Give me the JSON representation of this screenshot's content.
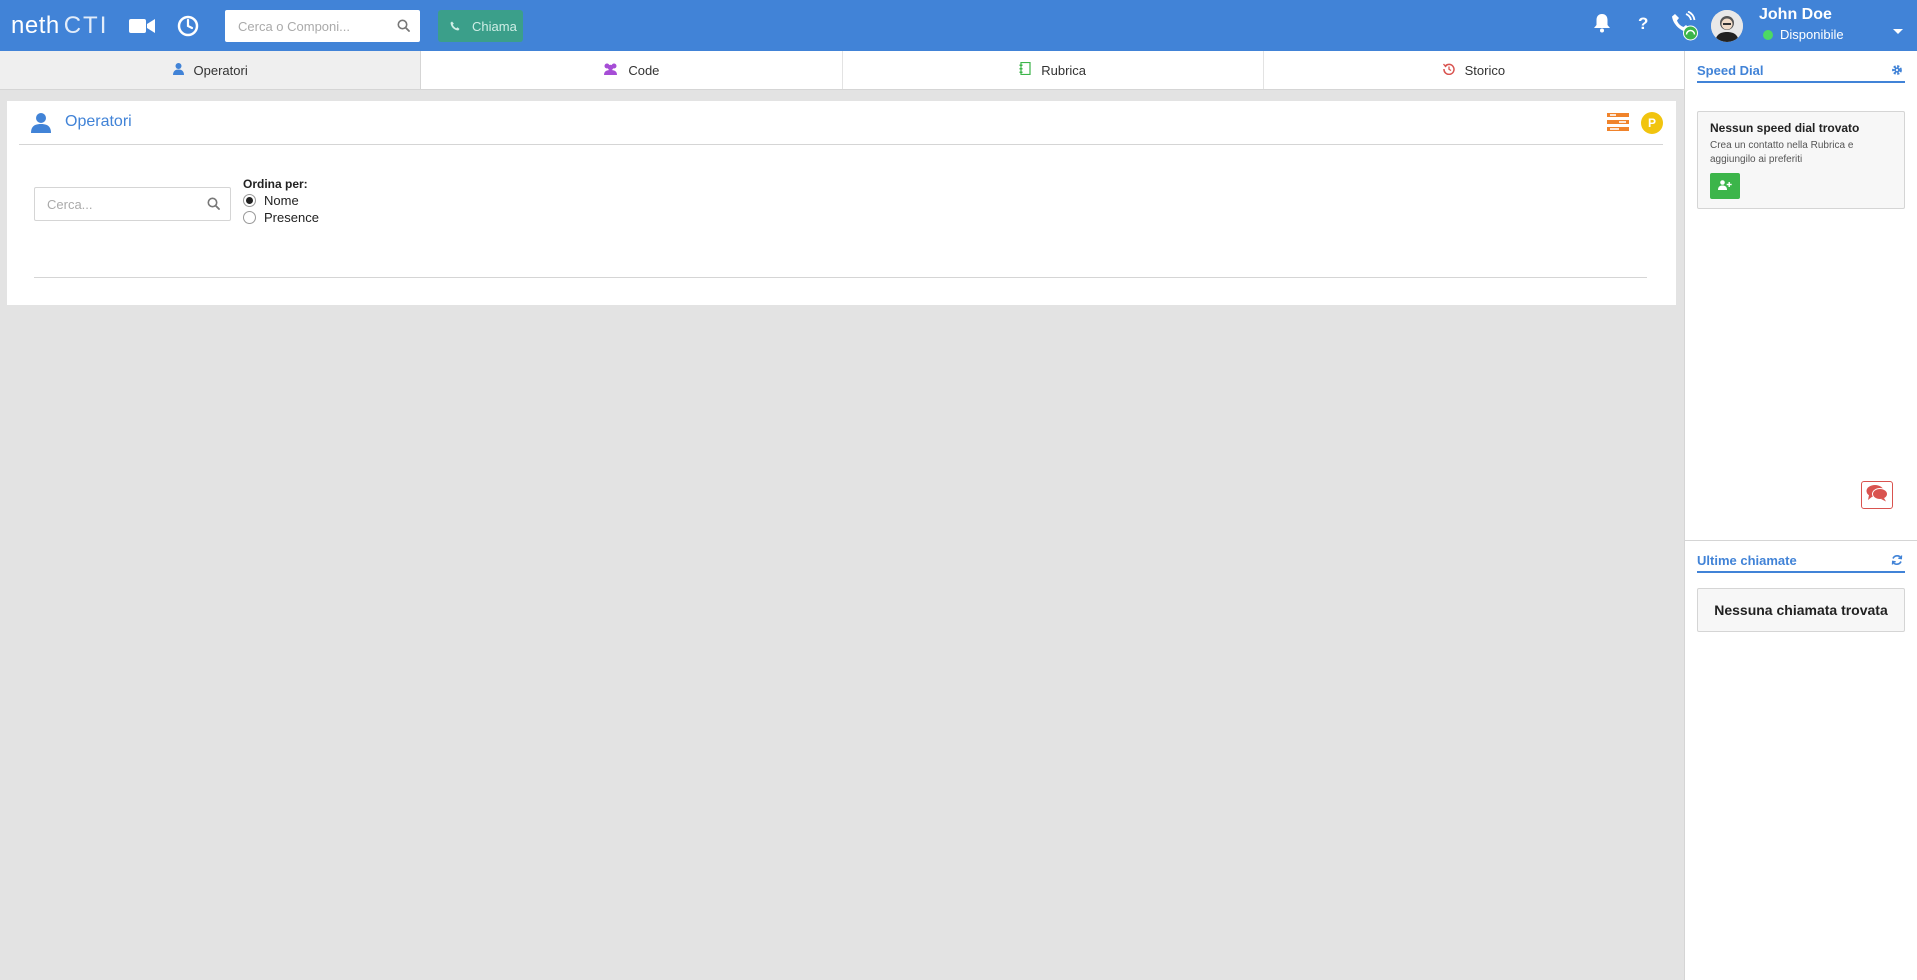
{
  "topbar": {
    "logo_main": "neth",
    "logo_suffix": "CTI",
    "search_placeholder": "Cerca o Componi...",
    "call_label": "Chiama",
    "help_label": "?",
    "user_name": "John Doe",
    "user_status": "Disponibile",
    "accent_color": "#4183d7",
    "status_color": "#4cd964"
  },
  "tabs": [
    {
      "label": "Operatori",
      "icon": "user-icon",
      "color": "#4183d7",
      "active": true
    },
    {
      "label": "Code",
      "icon": "users-icon",
      "color": "#a64dd6",
      "active": false
    },
    {
      "label": "Rubrica",
      "icon": "address-book-icon",
      "color": "#3cb54a",
      "active": false
    },
    {
      "label": "Storico",
      "icon": "history-icon",
      "color": "#d9534f",
      "active": false
    }
  ],
  "operators": {
    "title": "Operatori",
    "search_placeholder": "Cerca...",
    "sort_label": "Ordina per:",
    "sort_options": [
      {
        "label": "Nome",
        "selected": true
      },
      {
        "label": "Presence",
        "selected": false
      }
    ],
    "presence_badge": "P"
  },
  "speed_dial": {
    "title": "Speed Dial",
    "empty_title": "Nessun speed dial trovato",
    "empty_desc": "Crea un contatto nella Rubrica e aggiungilo ai preferiti"
  },
  "last_calls": {
    "title": "Ultime chiamate",
    "empty_text": "Nessuna chiamata trovata"
  }
}
